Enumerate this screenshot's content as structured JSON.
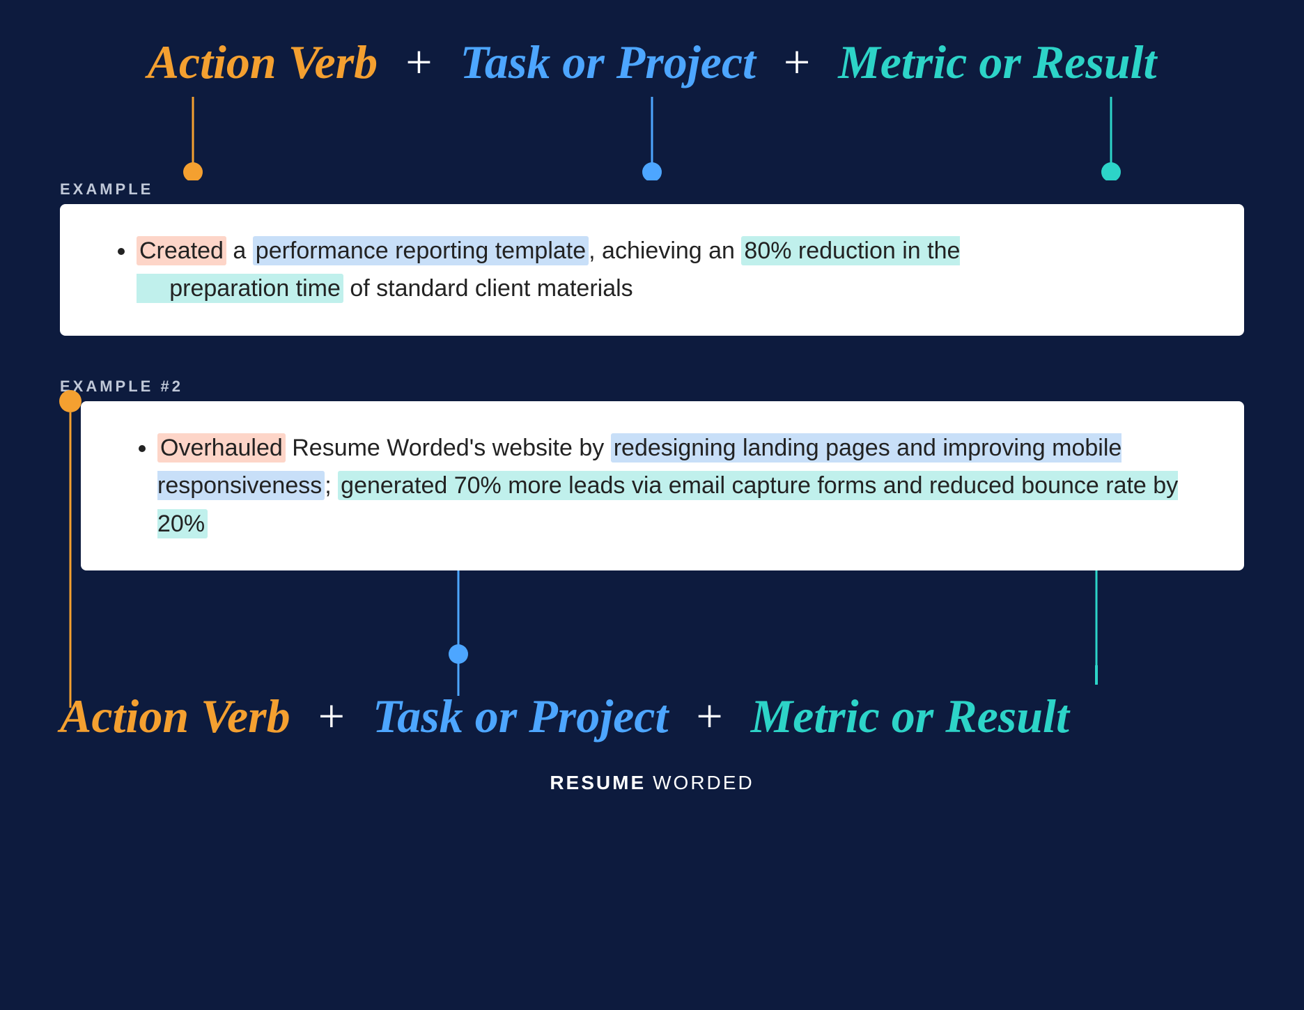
{
  "header": {
    "action_verb": "Action Verb",
    "task_or_project": "Task or Project",
    "metric_or_result": "Metric or Result",
    "plus": "+"
  },
  "example1": {
    "label": "EXAMPLE",
    "text_before_highlight1": "",
    "action_word": "Created",
    "text_mid1": " a ",
    "task_highlight": "performance reporting template",
    "text_mid2": ", achieving an ",
    "metric_highlight": "80% reduction in the preparation time",
    "text_after": " of standard client materials"
  },
  "example2": {
    "label": "EXAMPLE #2",
    "action_word": "Overhauled",
    "text_mid1": " Resume Worded's website by ",
    "task_highlight": "redesigning landing pages and improving mobile responsiveness",
    "text_mid2": "; ",
    "metric_highlight": "generated 70% more leads via email capture forms and reduced bounce rate by 20%",
    "text_after": ""
  },
  "footer": {
    "resume": "RESUME",
    "worded": "WORDED"
  },
  "colors": {
    "orange": "#f4a030",
    "blue": "#4da6ff",
    "teal": "#2dd4c8",
    "bg": "#0d1b3e",
    "highlight_orange": "#fdd5c8",
    "highlight_blue": "#c8dff8",
    "highlight_teal": "#c0f0ec"
  }
}
